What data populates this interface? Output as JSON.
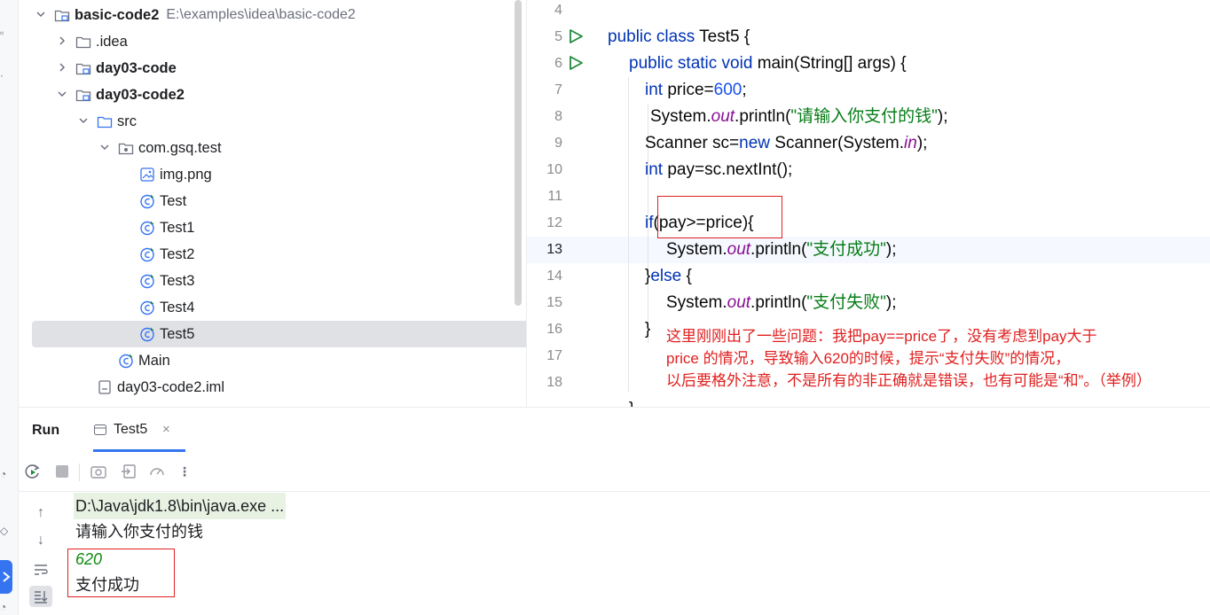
{
  "project_tree": {
    "items": [
      {
        "label": "basic-code2",
        "path_hint": "E:\\examples\\idea\\basic-code2",
        "icon": "module-folder-icon",
        "chevron": "down",
        "bold": true,
        "indent": 0
      },
      {
        "label": ".idea",
        "icon": "folder-icon",
        "chevron": "right",
        "bold": false,
        "indent": 1
      },
      {
        "label": "day03-code",
        "icon": "module-folder-icon",
        "chevron": "right",
        "bold": true,
        "indent": 1
      },
      {
        "label": "day03-code2",
        "icon": "module-folder-icon",
        "chevron": "down",
        "bold": true,
        "indent": 1
      },
      {
        "label": "src",
        "icon": "source-folder-icon",
        "chevron": "down",
        "bold": false,
        "indent": 2
      },
      {
        "label": "com.gsq.test",
        "icon": "package-icon",
        "chevron": "down",
        "bold": false,
        "indent": 3
      },
      {
        "label": "img.png",
        "icon": "image-file-icon",
        "chevron": "",
        "bold": false,
        "indent": 4
      },
      {
        "label": "Test",
        "icon": "java-class-icon",
        "chevron": "",
        "bold": false,
        "indent": 4
      },
      {
        "label": "Test1",
        "icon": "java-class-icon",
        "chevron": "",
        "bold": false,
        "indent": 4
      },
      {
        "label": "Test2",
        "icon": "java-class-icon",
        "chevron": "",
        "bold": false,
        "indent": 4
      },
      {
        "label": "Test3",
        "icon": "java-class-icon",
        "chevron": "",
        "bold": false,
        "indent": 4
      },
      {
        "label": "Test4",
        "icon": "java-class-icon",
        "chevron": "",
        "bold": false,
        "indent": 4
      },
      {
        "label": "Test5",
        "icon": "java-class-icon",
        "chevron": "",
        "bold": false,
        "indent": 4,
        "selected": true
      },
      {
        "label": "Main",
        "icon": "java-class-icon",
        "chevron": "",
        "bold": false,
        "indent": 3
      },
      {
        "label": "day03-code2.iml",
        "icon": "iml-file-icon",
        "chevron": "",
        "bold": false,
        "indent": 2
      }
    ]
  },
  "editor": {
    "line_numbers": [
      "4",
      "5",
      "6",
      "7",
      "8",
      "9",
      "10",
      "11",
      "12",
      "13",
      "14",
      "15",
      "16",
      "17",
      "18"
    ],
    "current_line": "13",
    "code": {
      "l5": [
        [
          "kw",
          "public class "
        ],
        [
          "",
          "Test5 {"
        ]
      ],
      "l6": [
        [
          "kw",
          "public static void "
        ],
        [
          "",
          "main(String[] args) {"
        ]
      ],
      "l7": [
        [
          "kw",
          "int "
        ],
        [
          "",
          "price="
        ],
        [
          "num",
          "600"
        ],
        [
          "",
          ";"
        ]
      ],
      "l8": [
        [
          "",
          "System."
        ],
        [
          "fld",
          "out"
        ],
        [
          "",
          ".println("
        ],
        [
          "str",
          "\"请输入你支付的钱\""
        ],
        [
          "",
          ");"
        ]
      ],
      "l9": [
        [
          "",
          "Scanner sc="
        ],
        [
          "kw",
          "new "
        ],
        [
          "",
          "Scanner(System."
        ],
        [
          "fld",
          "in"
        ],
        [
          "",
          ");"
        ]
      ],
      "l10": [
        [
          "kw",
          "int "
        ],
        [
          "",
          "pay=sc.nextInt();"
        ]
      ],
      "l12": [
        [
          "kw",
          "if"
        ],
        [
          "",
          "(pay>=price){"
        ]
      ],
      "l13": [
        [
          "",
          "System."
        ],
        [
          "fld",
          "out"
        ],
        [
          "",
          ".println("
        ],
        [
          "str",
          "\"支付成功\""
        ],
        [
          "",
          ");"
        ]
      ],
      "l14": [
        [
          "",
          "}"
        ],
        [
          "kw",
          "else "
        ],
        [
          "",
          "{"
        ]
      ],
      "l15": [
        [
          "",
          "System."
        ],
        [
          "fld",
          "out"
        ],
        [
          "",
          ".println("
        ],
        [
          "str",
          "\"支付失败\""
        ],
        [
          "",
          ");"
        ]
      ],
      "l16": [
        [
          "",
          "}"
        ]
      ],
      "l19": [
        [
          "",
          "}"
        ]
      ]
    },
    "annotation": [
      "这里刚刚出了一些问题：我把pay==price了，没有考虑到pay大于",
      "price 的情况，导致输入620的时候，提示“支付失败”的情况，",
      "以后要格外注意，不是所有的非正确就是错误，也有可能是“和”。（举例）"
    ]
  },
  "run_panel": {
    "title": "Run",
    "tab_label": "Test5",
    "toolbar_icons": [
      "rerun-icon",
      "stop-icon",
      "screenshot-icon",
      "restore-layout-icon",
      "coverage-icon",
      "more-options-icon"
    ],
    "console": {
      "command": "D:\\Java\\jdk1.8\\bin\\java.exe ...",
      "prompt": "请输入你支付的钱",
      "input": "620",
      "result": "支付成功"
    }
  },
  "colors": {
    "keyword": "#0033b3",
    "string": "#067d17",
    "field": "#871094",
    "number": "#1750eb",
    "annotation": "#e02020",
    "input_text": "#0f8a0f",
    "accent": "#3574f0"
  }
}
